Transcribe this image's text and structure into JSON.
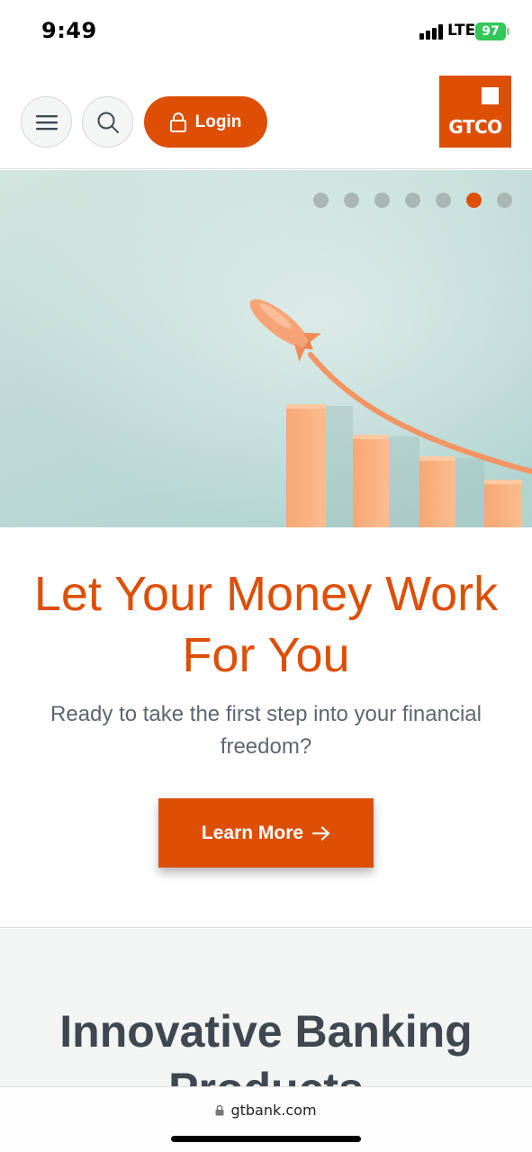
{
  "status_bar": {
    "time": "9:49",
    "network": "LTE",
    "battery": "97"
  },
  "header": {
    "menu_icon": "hamburger-menu-icon",
    "search_icon": "search-icon",
    "login_label": "Login",
    "login_icon": "lock-icon",
    "logo_text": "GTCO"
  },
  "hero": {
    "slide_count": 7,
    "active_slide": 6
  },
  "main": {
    "headline": "Let Your Money Work For You",
    "subtext": "Ready to take the first step into your financial freedom?",
    "cta_label": "Learn More",
    "cta_icon": "arrow-right-icon"
  },
  "products": {
    "title": "Innovative Banking Products"
  },
  "browser": {
    "url": "gtbank.com"
  },
  "colors": {
    "brand": "#dd4f05",
    "text_dark": "#3f4750",
    "text_muted": "#5e6670"
  }
}
